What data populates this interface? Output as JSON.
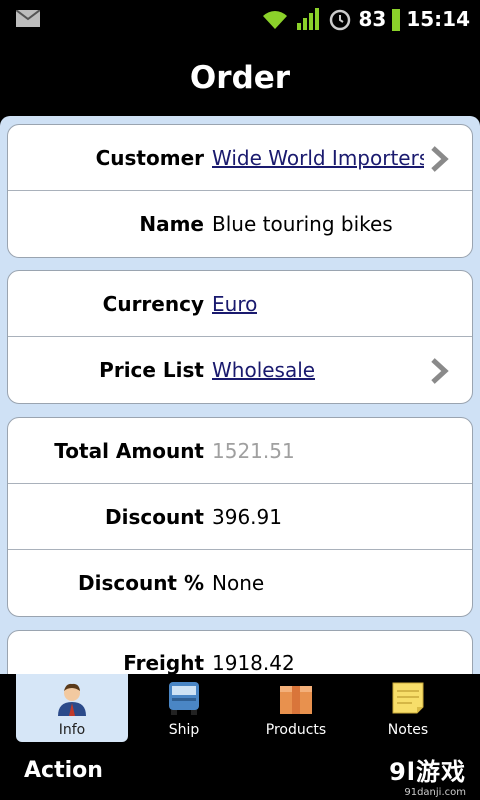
{
  "status_bar": {
    "icons": [
      "mail-icon",
      "wifi-icon",
      "signal-icon",
      "alarm-icon",
      "battery-icon"
    ],
    "battery_percent": "83",
    "time": "15:14"
  },
  "page": {
    "title": "Order"
  },
  "groups": [
    {
      "rows": [
        {
          "label": "Customer",
          "value": "Wide World Importers",
          "link": true,
          "chevron": true
        },
        {
          "label": "Name",
          "value": "Blue touring bikes",
          "link": false,
          "chevron": false
        }
      ]
    },
    {
      "rows": [
        {
          "label": "Currency",
          "value": "Euro",
          "link": true,
          "chevron": false
        },
        {
          "label": "Price List",
          "value": "Wholesale",
          "link": true,
          "chevron": true
        }
      ]
    },
    {
      "rows": [
        {
          "label": "Total Amount",
          "value": "1521.51",
          "muted": true
        },
        {
          "label": "Discount",
          "value": "396.91"
        },
        {
          "label": "Discount %",
          "value": "None"
        }
      ]
    },
    {
      "rows": [
        {
          "label": "Freight",
          "value": "1918.42"
        }
      ]
    }
  ],
  "tabs": [
    {
      "label": "Info",
      "icon": "user-icon",
      "active": true
    },
    {
      "label": "Ship",
      "icon": "truck-icon",
      "active": false
    },
    {
      "label": "Products",
      "icon": "box-icon",
      "active": false
    },
    {
      "label": "Notes",
      "icon": "note-icon",
      "active": false
    }
  ],
  "action_bar": {
    "label": "Action",
    "watermark": "9l游戏",
    "watermark_url": "91danji.com"
  }
}
